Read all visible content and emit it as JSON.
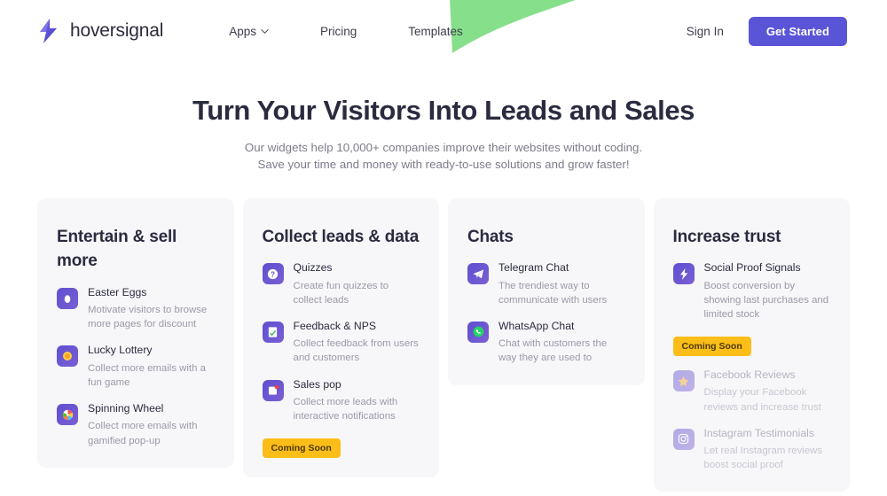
{
  "colors": {
    "accent": "#5a55d6",
    "badge": "#fbbd18",
    "blob": "#86df8b",
    "card_bg": "#f7f7f9",
    "heading": "#2b2b40",
    "muted_text": "#9a9aa8"
  },
  "header": {
    "brand_name": "hoversignal",
    "brand_icon": "lightning-bolt-icon",
    "nav": [
      {
        "label": "Apps",
        "has_dropdown": true
      },
      {
        "label": "Pricing",
        "has_dropdown": false
      },
      {
        "label": "Templates",
        "has_dropdown": false
      }
    ],
    "sign_in_label": "Sign In",
    "cta_label": "Get Started"
  },
  "hero": {
    "title": "Turn Your Visitors Into Leads and Sales",
    "subtitle_line1": "Our widgets help 10,000+ companies improve their websites without coding.",
    "subtitle_line2": "Save your time and money with ready-to-use solutions and grow faster!"
  },
  "cards": [
    {
      "title": "Entertain & sell more",
      "badge": null,
      "features": [
        {
          "icon": "easter-egg-icon",
          "name": "Easter Eggs",
          "desc": "Motivate visitors to browse more pages for discount",
          "muted": false
        },
        {
          "icon": "lottery-coin-icon",
          "name": "Lucky Lottery",
          "desc": "Collect more emails with a fun game",
          "muted": false
        },
        {
          "icon": "spinning-wheel-icon",
          "name": "Spinning Wheel",
          "desc": "Collect more emails with gamified pop-up",
          "muted": false
        }
      ]
    },
    {
      "title": "Collect leads & data",
      "badge": "Coming Soon",
      "features": [
        {
          "icon": "question-mark-icon",
          "name": "Quizzes",
          "desc": "Create fun quizzes to collect leads",
          "muted": false
        },
        {
          "icon": "clipboard-check-icon",
          "name": "Feedback & NPS",
          "desc": "Collect feedback from users and customers",
          "muted": false
        },
        {
          "icon": "notification-popup-icon",
          "name": "Sales pop",
          "desc": "Collect more leads with interactive notifications",
          "muted": false
        }
      ]
    },
    {
      "title": "Chats",
      "badge": null,
      "features": [
        {
          "icon": "telegram-icon",
          "name": "Telegram Chat",
          "desc": "The trendiest way to communicate with users",
          "muted": false
        },
        {
          "icon": "whatsapp-icon",
          "name": "WhatsApp Chat",
          "desc": "Chat with customers the way they are used to",
          "muted": false
        }
      ]
    },
    {
      "title": "Increase trust",
      "badge": "Coming Soon",
      "badge_after_index": 0,
      "features": [
        {
          "icon": "lightning-bolt-icon",
          "name": "Social Proof Signals",
          "desc": "Boost conversion by showing last purchases and limited stock",
          "muted": false
        },
        {
          "icon": "star-icon",
          "name": "Facebook Reviews",
          "desc": "Display your Facebook reviews and increase trust",
          "muted": true
        },
        {
          "icon": "instagram-icon",
          "name": "Instagram Testimonials",
          "desc": "Let real Instagram reviews boost social proof",
          "muted": true
        }
      ]
    }
  ]
}
